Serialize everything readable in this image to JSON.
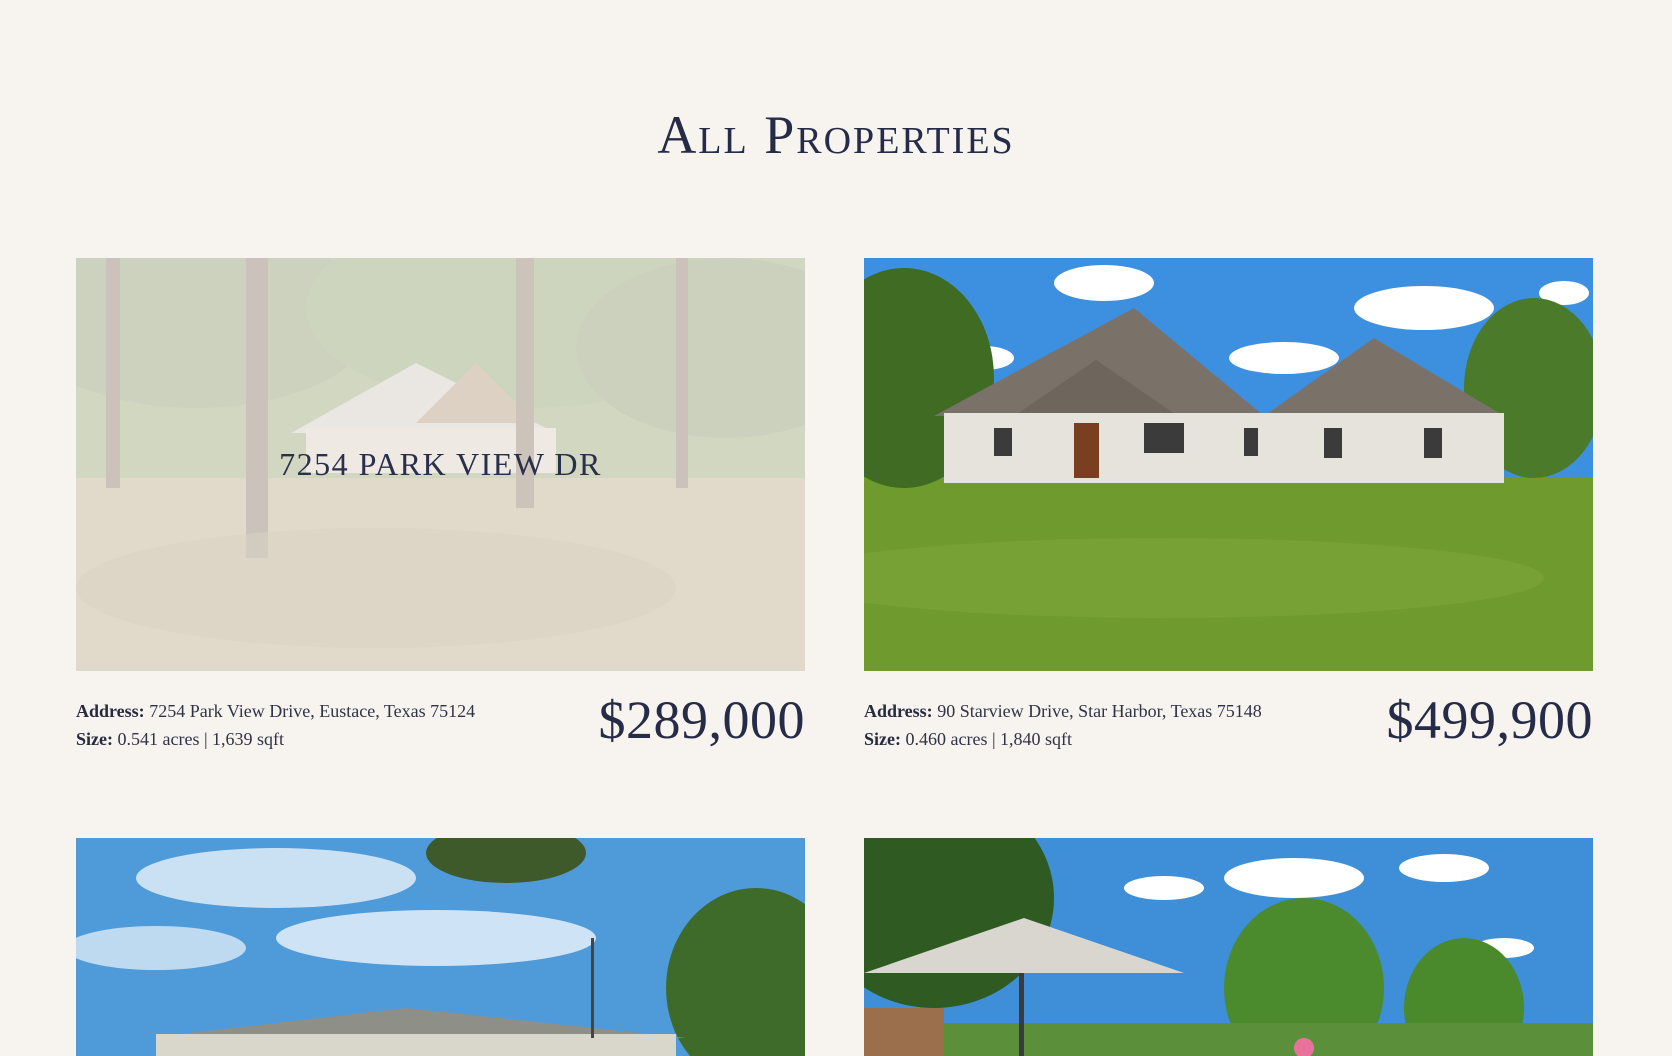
{
  "page": {
    "title": "All Properties"
  },
  "listings": [
    {
      "overlay_label": "7254 PARK VIEW DR",
      "address_label": "Address:",
      "address": "7254 Park View Drive, Eustace, Texas 75124",
      "size_label": "Size:",
      "size": "0.541 acres | 1,639 sqft",
      "price": "$289,000",
      "image": "wooded-lot-house-photo"
    },
    {
      "address_label": "Address:",
      "address": "90 Starview Drive, Star Harbor, Texas 75148",
      "size_label": "Size:",
      "size": "0.460 acres | 1,840 sqft",
      "price": "$499,900",
      "image": "white-brick-house-photo"
    },
    {
      "image": "ranch-house-sky-photo"
    },
    {
      "image": "lake-patio-umbrella-photo"
    }
  ],
  "colors": {
    "background": "#f7f3ee",
    "heading": "#262b47",
    "text": "#2f3346"
  }
}
